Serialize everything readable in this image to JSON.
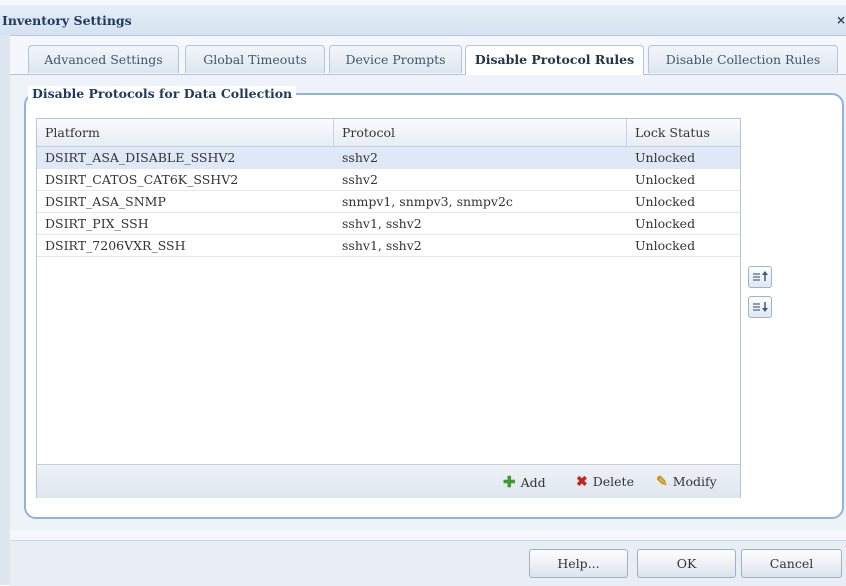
{
  "window": {
    "title": "Inventory Settings",
    "close_glyph": "×"
  },
  "tabs": [
    {
      "label": "Advanced Settings"
    },
    {
      "label": "Global Timeouts"
    },
    {
      "label": "Device Prompts"
    },
    {
      "label": "Disable Protocol Rules",
      "active": true
    },
    {
      "label": "Disable Collection Rules"
    }
  ],
  "group": {
    "legend": "Disable Protocols for Data Collection"
  },
  "table": {
    "columns": [
      "Platform",
      "Protocol",
      "Lock Status"
    ],
    "rows": [
      [
        "DSIRT_ASA_DISABLE_SSHV2",
        "sshv2",
        "Unlocked"
      ],
      [
        "DSIRT_CATOS_CAT6K_SSHV2",
        "sshv2",
        "Unlocked"
      ],
      [
        "DSIRT_ASA_SNMP",
        "snmpv1, snmpv3, snmpv2c",
        "Unlocked"
      ],
      [
        "DSIRT_PIX_SSH",
        "sshv1, sshv2",
        "Unlocked"
      ],
      [
        "DSIRT_7206VXR_SSH",
        "sshv1, sshv2",
        "Unlocked"
      ]
    ],
    "selected_row": 0
  },
  "toolbar": {
    "add_label": "Add",
    "delete_label": "Delete",
    "modify_label": "Modify",
    "add_icon": "plus-icon",
    "delete_icon": "x-icon",
    "modify_icon": "pencil-icon"
  },
  "side_buttons": {
    "move_up_icon": "move-up-icon",
    "move_down_icon": "move-down-icon"
  },
  "footer": {
    "help_label": "Help...",
    "ok_label": "OK",
    "cancel_label": "Cancel"
  },
  "colors": {
    "accent": "#8fb3dd",
    "title": "#1f3a60",
    "add": "#3d9a2c",
    "delete": "#c0281c",
    "modify": "#c89a1c"
  }
}
